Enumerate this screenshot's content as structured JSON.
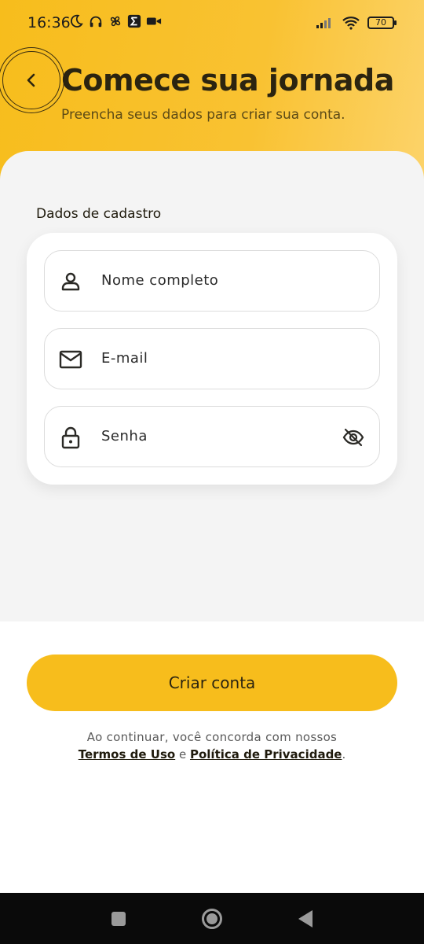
{
  "status_bar": {
    "time": "16:36",
    "battery": "70",
    "icons_left": [
      "moon-icon",
      "headphones-icon",
      "fan-icon",
      "sigma-app-icon",
      "video-camera-icon"
    ],
    "icons_right": [
      "signal-icon",
      "wifi-icon",
      "battery-icon"
    ]
  },
  "header": {
    "title": "Comece sua jornada",
    "subtitle": "Preencha seus dados para criar sua conta.",
    "back_icon": "chevron-left-icon"
  },
  "form": {
    "section_label": "Dados de cadastro",
    "fields": [
      {
        "name": "full-name",
        "placeholder": "Nome completo",
        "icon": "person-icon"
      },
      {
        "name": "email",
        "placeholder": "E-mail",
        "icon": "mail-icon"
      },
      {
        "name": "password",
        "placeholder": "Senha",
        "icon": "lock-icon",
        "trailing_icon": "eye-off-icon"
      }
    ]
  },
  "actions": {
    "primary_label": "Criar conta"
  },
  "legal": {
    "line1": "Ao continuar, você concorda com nossos",
    "terms": "Termos de Uso",
    "and": "e",
    "privacy": "Política de Privacidade",
    "end": "."
  },
  "colors": {
    "accent": "#f7bd1c",
    "text_dark": "#2b2410",
    "sheet_bg": "#f4f4f4",
    "nav_bg": "#0a0a0a"
  }
}
